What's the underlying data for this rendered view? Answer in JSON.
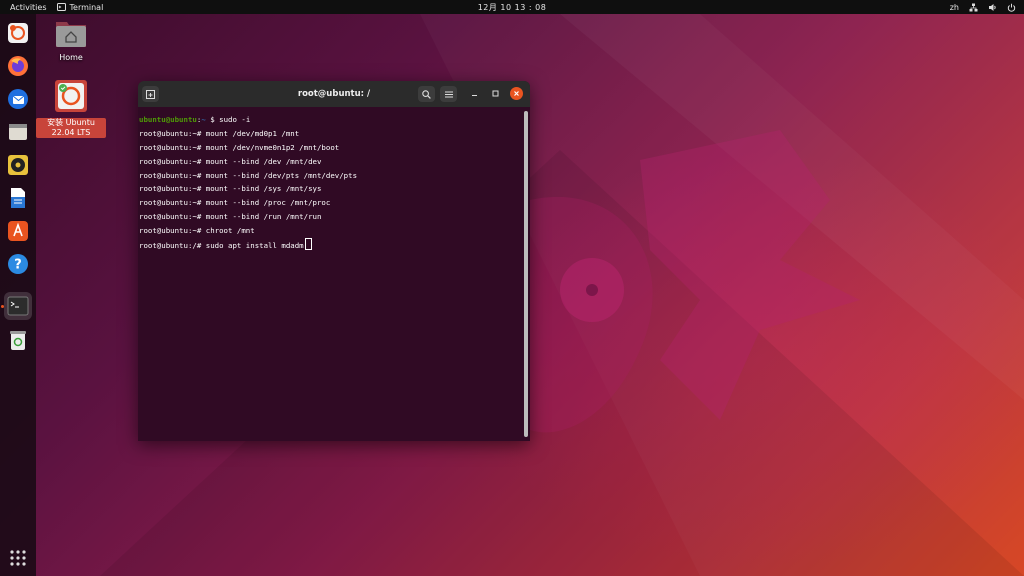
{
  "topbar": {
    "activities": "Activities",
    "app_name": "Terminal",
    "clock": "12月 10  13 : 08",
    "input_method": "zh",
    "icons": [
      "network-icon",
      "volume-icon",
      "power-icon"
    ]
  },
  "dock": {
    "items": [
      "ubuntu-installer-icon",
      "firefox-icon",
      "thunderbird-icon",
      "files-icon",
      "rhythmbox-icon",
      "libreoffice-writer-icon",
      "app-center-icon",
      "help-icon",
      "terminal-icon",
      "trash-icon"
    ],
    "show_apps": "show-applications-icon"
  },
  "desktop": {
    "home_label": "Home",
    "installer_label": "安装 Ubuntu 22.04 LTS"
  },
  "terminal": {
    "title": "root@ubuntu: /",
    "lines": [
      {
        "user": "ubuntu@ubuntu",
        "sep": ":",
        "path": "~",
        "cmd": "$ sudo -i"
      },
      {
        "text": "root@ubuntu:~# mount /dev/md0p1 /mnt"
      },
      {
        "text": "root@ubuntu:~# mount /dev/nvme0n1p2 /mnt/boot"
      },
      {
        "text": "root@ubuntu:~# mount --bind /dev /mnt/dev"
      },
      {
        "text": "root@ubuntu:~# mount --bind /dev/pts /mnt/dev/pts"
      },
      {
        "text": "root@ubuntu:~# mount --bind /sys /mnt/sys"
      },
      {
        "text": "root@ubuntu:~# mount --bind /proc /mnt/proc"
      },
      {
        "text": "root@ubuntu:~# mount --bind /run /mnt/run"
      },
      {
        "text": "root@ubuntu:~# chroot /mnt"
      },
      {
        "text": "root@ubuntu:/# sudo apt install mdadm"
      }
    ]
  },
  "colors": {
    "terminal_bg": "#300a24",
    "accent": "#e95420",
    "prompt_user": "#4e9a06",
    "prompt_path": "#3465a4"
  }
}
